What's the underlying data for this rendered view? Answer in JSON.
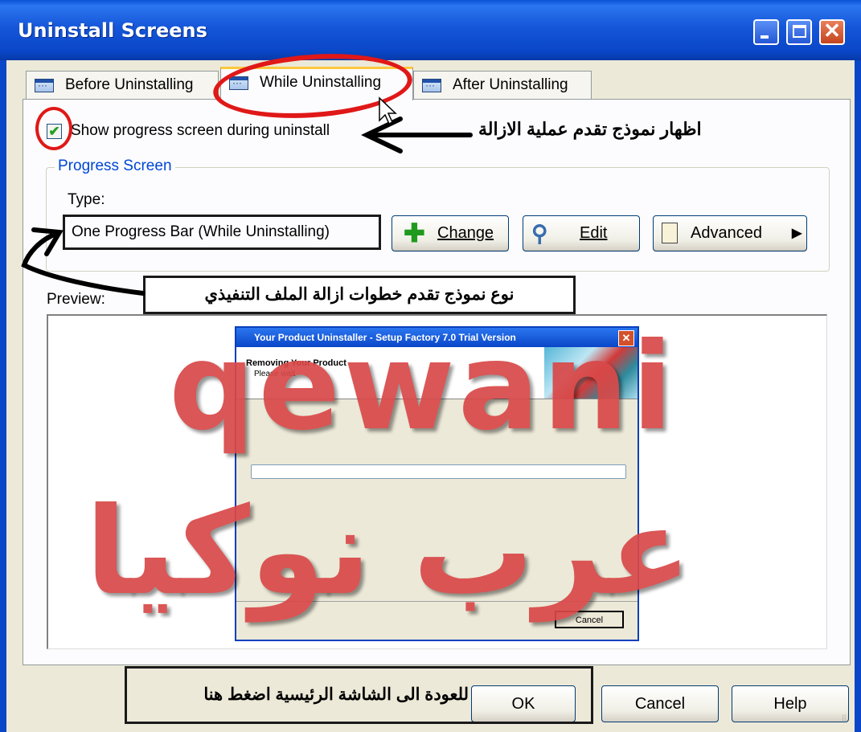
{
  "window": {
    "title": "Uninstall Screens",
    "controls": {
      "minimize": "_",
      "maximize": "□",
      "close": "✕"
    }
  },
  "tabs": [
    {
      "label": "Before Uninstalling",
      "active": false
    },
    {
      "label": "While Uninstalling",
      "active": true
    },
    {
      "label": "After Uninstalling",
      "active": false
    }
  ],
  "show_progress": {
    "label": "Show progress screen during uninstall",
    "checked": true
  },
  "progress_screen": {
    "group_label": "Progress Screen",
    "type_label": "Type:",
    "type_value": "One Progress Bar (While Uninstalling)",
    "buttons": {
      "change": "Change",
      "edit": "Edit",
      "advanced": "Advanced"
    }
  },
  "preview": {
    "label": "Preview:",
    "mini_window": {
      "title": "Your Product Uninstaller - Setup Factory 7.0 Trial Version",
      "heading": "Removing Your Product",
      "subheading": "Please wait",
      "cancel": "Cancel"
    }
  },
  "annotations": {
    "show_progress_note": "اظهار نموذج تقدم عملية الازالة",
    "type_note": "نوع نموذج تقدم خطوات ازالة الملف التنفيذي",
    "ok_note": "للعودة الى الشاشة الرئيسية اضغط هنا"
  },
  "watermark": {
    "line1": "qewani",
    "line2": "عرب نوكيا",
    "color": "#d94848"
  },
  "footer": {
    "ok": "OK",
    "cancel": "Cancel",
    "help": "Help"
  },
  "colors": {
    "title_bar": "#0a46c8",
    "accent_red": "#e01818",
    "group_label": "#0046d5"
  }
}
